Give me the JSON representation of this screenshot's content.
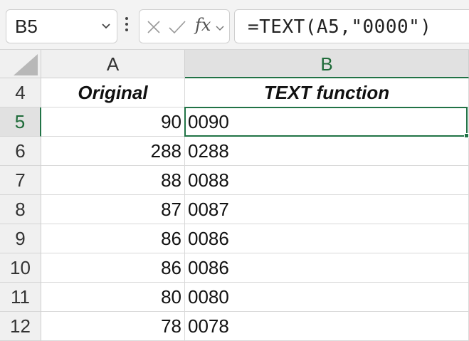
{
  "name_box": {
    "value": "B5"
  },
  "formula_bar": {
    "formula": "=TEXT(A5,\"0000\")",
    "fx_label": "fx"
  },
  "columns": [
    "A",
    "B"
  ],
  "selected_column": "B",
  "selected_row": "5",
  "rows": [
    {
      "row": "4",
      "a": "Original",
      "b": "TEXT function",
      "header": true
    },
    {
      "row": "5",
      "a": "90",
      "b": "0090"
    },
    {
      "row": "6",
      "a": "288",
      "b": "0288"
    },
    {
      "row": "7",
      "a": "88",
      "b": "0088"
    },
    {
      "row": "8",
      "a": "87",
      "b": "0087"
    },
    {
      "row": "9",
      "a": "86",
      "b": "0086"
    },
    {
      "row": "10",
      "a": "86",
      "b": "0086"
    },
    {
      "row": "11",
      "a": "80",
      "b": "0080"
    },
    {
      "row": "12",
      "a": "78",
      "b": "0078"
    }
  ],
  "colors": {
    "accent": "#217346"
  }
}
